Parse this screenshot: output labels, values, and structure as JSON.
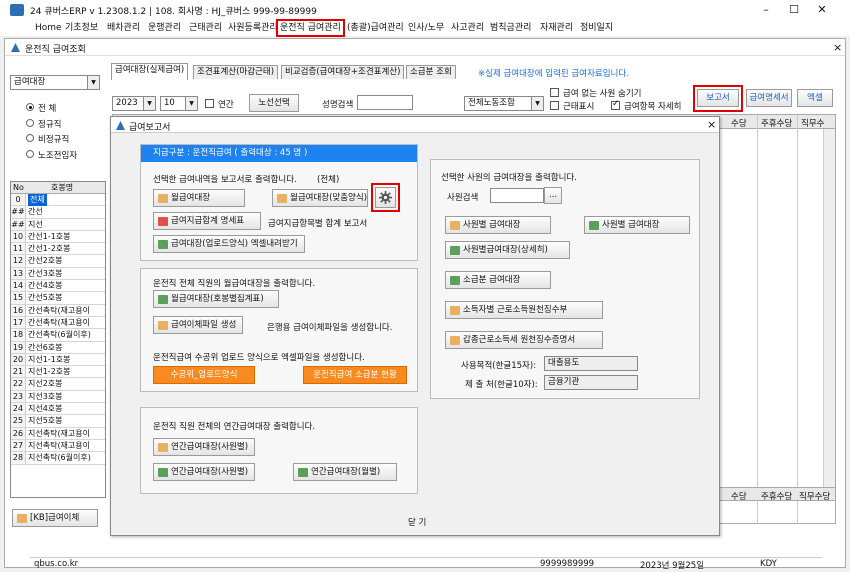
{
  "app": {
    "title": "24 큐버스ERP v 1.2308.1.2  |  108. 회사명 : HJ_큐버스  999-99-89999",
    "window_controls": [
      "–",
      "☐",
      "✕"
    ]
  },
  "menu": [
    "Home",
    "기초정보",
    "배차관리",
    "운행관리",
    "근태관리",
    "사원등록관리",
    "운전직 급여관리",
    "(총괄)급여관리",
    "인사/노무",
    "사고관리",
    "범칙금관리",
    "자재관리",
    "정비일지"
  ],
  "inner": {
    "title": "운전직 급여조회",
    "close": "×",
    "left_select": "급여대장",
    "radios": [
      "전 체",
      "정규직",
      "비정규직",
      "노조전임자"
    ],
    "tabs": [
      "급여대장(실제급여)",
      "조견표계산(마감근태)",
      "비교검증(급여대장+조견표계산)",
      "소급분 조회"
    ],
    "notice": "※실제 급여대장에 입력된 급여자료입니다.",
    "year": "2023",
    "month": "10",
    "annual_label": "연간",
    "route_btn": "노선선택",
    "name_search_label": "성명검색",
    "union_select": "전체노동조합",
    "hide_no_pay_label": "급여 없는 사원 숨기기",
    "attendance_label": "근태표시",
    "pay_detail_label": "급여항목 자세히",
    "report_btn": "보고서",
    "statement_btn": "급여명세서",
    "excel_btn": "엑셀",
    "grid_headers": [
      "수당",
      "주휴수당",
      "직무수"
    ],
    "footer_headers": [
      "수당",
      "주휴수당",
      "직무수당"
    ],
    "kb_btn": "[KB]급여이체",
    "emp_header": [
      "No",
      "호봉명"
    ],
    "emp_rows": [
      [
        "0",
        "전체"
      ],
      [
        "##",
        "간선"
      ],
      [
        "##",
        "지선"
      ],
      [
        "10",
        "간선1-1호봉"
      ],
      [
        "11",
        "간선1-2호봉"
      ],
      [
        "12",
        "간선2호봉"
      ],
      [
        "13",
        "간선3호봉"
      ],
      [
        "14",
        "간선4호봉"
      ],
      [
        "15",
        "간선5호봉"
      ],
      [
        "16",
        "간선촉탁(재고용이"
      ],
      [
        "17",
        "간선촉탁(재고용이"
      ],
      [
        "18",
        "간선촉탁(6월이후)"
      ],
      [
        "19",
        "간선6호봉"
      ],
      [
        "20",
        "지선1-1호봉"
      ],
      [
        "21",
        "지선1-2호봉"
      ],
      [
        "22",
        "지선2호봉"
      ],
      [
        "23",
        "지선3호봉"
      ],
      [
        "24",
        "지선4호봉"
      ],
      [
        "25",
        "지선5호봉"
      ],
      [
        "26",
        "지선촉탁(재고용이"
      ],
      [
        "27",
        "지선촉탁(재고용이"
      ],
      [
        "28",
        "지선촉탁(6월이후)"
      ]
    ]
  },
  "dialog": {
    "title": "급여보고서",
    "close": "×",
    "banner": "지급구분 : 운전직급여 ( 출력대상 :  45 명 )",
    "p1_desc": "선택한 급여내역을 보고서로 출력합니다.",
    "p1_scope": "(전체)",
    "btn_ledger": "월급여대장",
    "btn_ledger_custom": "월급여대장(맞춤양식)",
    "btn_sum_statement": "급여지급합계 명세표",
    "sum_desc": "급여지급항목별 합계 보고서",
    "btn_upload_excel": "급여대장(업로드양식) 엑셀내려받기",
    "p2_desc": "운전직 전체 직원의 월급여대장을 출력합니다.",
    "btn_grade_sum": "월급여대장(호봉별집계표)",
    "btn_transfer_file": "급여이체파일 생성",
    "transfer_desc": "은행용 급여이체파일을 생성합니다.",
    "p2_desc2": "운전직급여 수공위 업로드 양식으로 엑셀파일을 생성합니다.",
    "btn_orange1": "수공위_업로드양식",
    "btn_orange2": "운전직급여 소급분 현황",
    "p3_desc": "운전직 직원 전체의 연간급여대장 출력합니다.",
    "btn_annual_emp1": "연간급여대장(사원별)",
    "btn_annual_emp2": "연간급여대장(사원별)",
    "btn_annual_month": "연간급여대장(월별)",
    "right_desc": "선택한 사원의 급여대장을 출력합니다.",
    "emp_search_label": "사원검색",
    "search_btn": "...",
    "btn_emp_ledger": "사원별 급여대장",
    "btn_emp_pay": "사원별 급여대장",
    "btn_emp_detail": "사원별급여대장(상세히)",
    "btn_retro": "소급분 급여대장",
    "btn_withholding": "소득자별 근로소득원천징수부",
    "btn_receipt": "갑종근로소득세 원천징수증명서",
    "purpose_label": "사용목적(한글15자):",
    "purpose_value": "대출용도",
    "submit_label": "제 출 처(한글10자):",
    "submit_value": "금융기관",
    "close_btn": "닫 기"
  },
  "status": {
    "site": "qbus.co.kr",
    "phone": "9999989999",
    "date": "2023년 9월25일",
    "user": "KDY"
  },
  "colors": {
    "banner": "#1e82f0",
    "highlight": "#e00000",
    "orange": "#f98a1f",
    "selection": "#0a64d8"
  }
}
